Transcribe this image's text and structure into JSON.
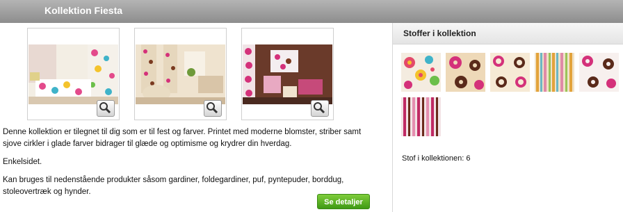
{
  "header": {
    "title": "Kollektion Fiesta"
  },
  "images": [
    {
      "name": "room-photo-bedroom"
    },
    {
      "name": "room-photo-living"
    },
    {
      "name": "room-photo-lounge"
    }
  ],
  "description": {
    "p1": "Denne kollektion er tilegnet til dig som er til fest og farver. Printet med moderne blomster, striber samt sjove cirkler i glade farver bidrager til glæde og optimisme og krydrer din hverdag.",
    "p2": "Enkelsidet.",
    "p3": "Kan bruges til nedenstående produkter såsom gardiner, foldegardiner, puf, pyntepuder, borddug, stoleovertræk og hynder."
  },
  "button": {
    "details_label": "Se detaljer"
  },
  "panel": {
    "title": "Stoffer i kollektion",
    "count_text": "Stof i kollektionen: 6"
  },
  "colors": {
    "header": "#9a9a9a",
    "button": "#4fae1f",
    "pink": "#d4317a",
    "brown": "#5a2a1a",
    "cream": "#f2e6c8"
  }
}
